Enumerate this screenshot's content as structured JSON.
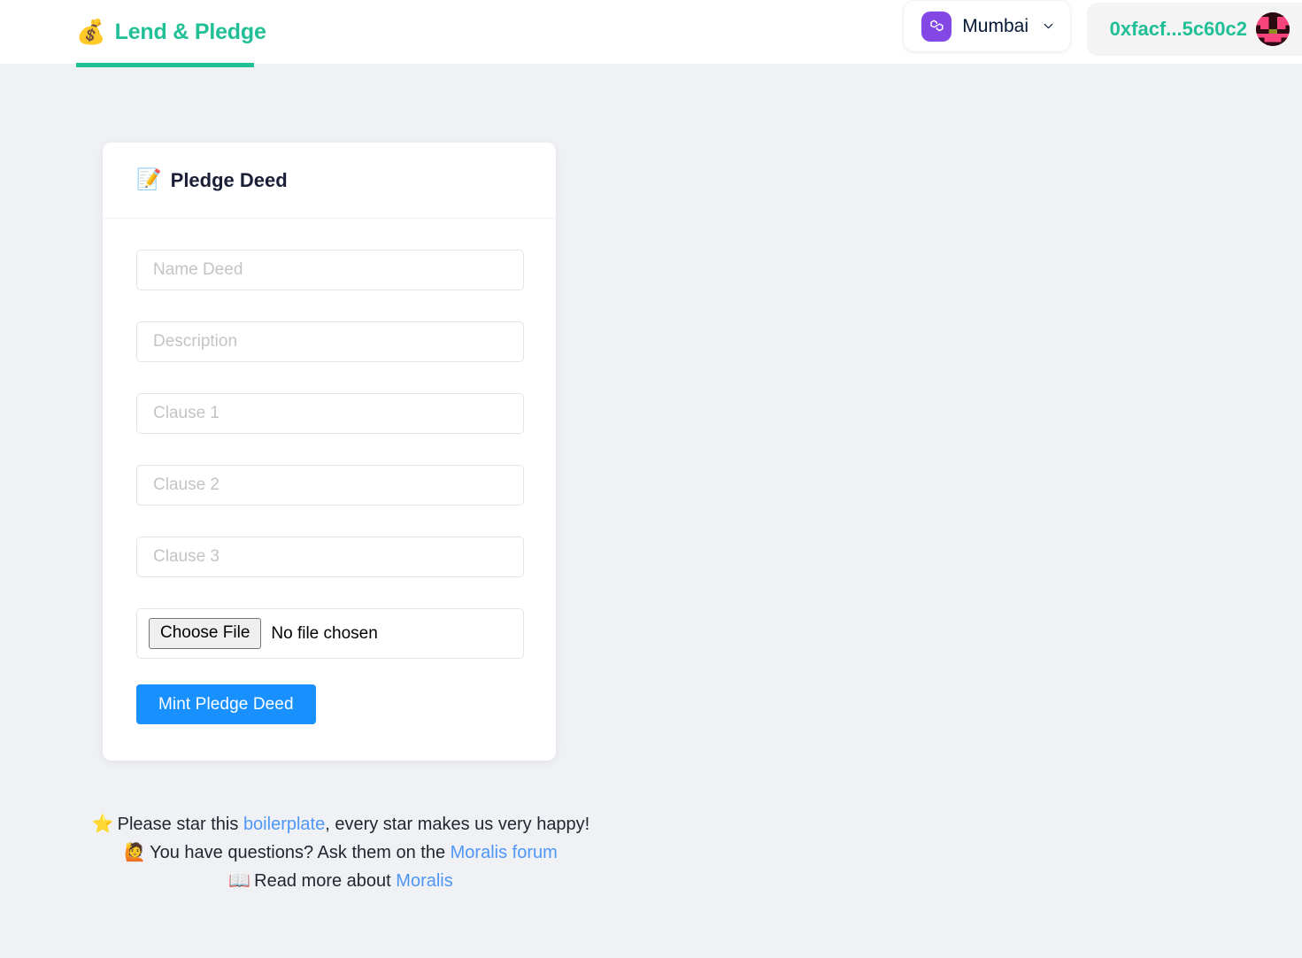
{
  "header": {
    "brand_emoji": "💰",
    "brand_emoji_name": "money-bag-icon",
    "brand_text": "Lend & Pledge",
    "brand_color": "#21bf96",
    "network": {
      "icon_name": "polygon-icon",
      "name": "Mumbai",
      "chevron_name": "chevron-down-icon",
      "icon_bg": "#8247e5"
    },
    "account": {
      "address": "0xfacf...5c60c2",
      "address_color": "#21bf96",
      "avatar_name": "blockie-avatar"
    }
  },
  "card": {
    "title_emoji": "📝",
    "title_emoji_name": "memo-icon",
    "title": "Pledge Deed",
    "fields": [
      {
        "name": "name-deed-input",
        "placeholder": "Name Deed",
        "value": ""
      },
      {
        "name": "description-input",
        "placeholder": "Description",
        "value": ""
      },
      {
        "name": "clause-1-input",
        "placeholder": "Clause 1",
        "value": ""
      },
      {
        "name": "clause-2-input",
        "placeholder": "Clause 2",
        "value": ""
      },
      {
        "name": "clause-3-input",
        "placeholder": "Clause 3",
        "value": ""
      }
    ],
    "file_input": {
      "button_label": "Choose File",
      "status": "No file chosen"
    },
    "submit_label": "Mint Pledge Deed",
    "submit_color": "#1890ff"
  },
  "footer": {
    "link_color": "#4f96f6",
    "lines": [
      {
        "emoji": "⭐",
        "emoji_name": "star-icon",
        "pre": "Please star this ",
        "link": "boilerplate",
        "post": ", every star makes us very happy!"
      },
      {
        "emoji": "🙋",
        "emoji_name": "raising-hand-icon",
        "pre": "You have questions? Ask them on the ",
        "link": "Moralis forum",
        "post": ""
      },
      {
        "emoji": "📖",
        "emoji_name": "open-book-icon",
        "pre": "Read more about ",
        "link": "Moralis",
        "post": ""
      }
    ]
  },
  "page": {
    "background": "#eff1f5"
  }
}
